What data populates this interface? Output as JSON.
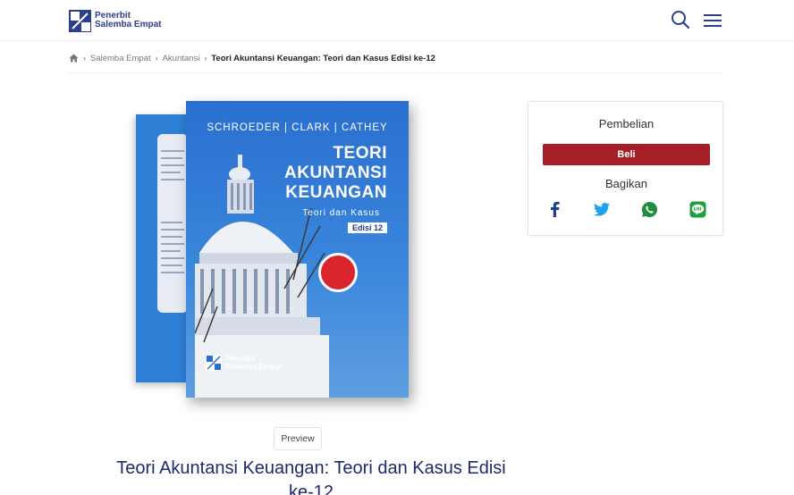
{
  "header": {
    "logo_line1": "Penerbit",
    "logo_line2": "Salemba Empat",
    "brand_color": "#2b3f8f",
    "search_icon": "search-icon",
    "menu_icon": "hamburger-menu-icon"
  },
  "breadcrumb": {
    "home_icon": "home-icon",
    "items": [
      "Salemba Empat",
      "Akuntansi"
    ],
    "current": "Teori Akuntansi Keuangan: Teori dan Kasus Edisi ke-12"
  },
  "cover": {
    "authors": "SCHROEDER  |  CLARK  |  CATHEY",
    "title_line1": "TEORI",
    "title_line2": "AKUNTANSI",
    "title_line3": "KEUANGAN",
    "subtitle": "Teori dan Kasus",
    "edition": "Edisi 12",
    "publisher_line1": "Penerbit",
    "publisher_line2": "Salemba Empat"
  },
  "preview": {
    "label": "Preview"
  },
  "product": {
    "title": "Teori Akuntansi Keuangan: Teori dan Kasus Edisi ke-12"
  },
  "purchase": {
    "heading": "Pembelian",
    "buy_label": "Beli",
    "buy_color": "#a41f27",
    "share_heading": "Bagikan",
    "share": [
      {
        "icon": "facebook-icon",
        "color": "#1d3f8f"
      },
      {
        "icon": "twitter-icon",
        "color": "#1da1f2"
      },
      {
        "icon": "whatsapp-icon",
        "color": "#1f8e3c"
      },
      {
        "icon": "line-icon",
        "color": "#1f9e3c"
      }
    ]
  }
}
